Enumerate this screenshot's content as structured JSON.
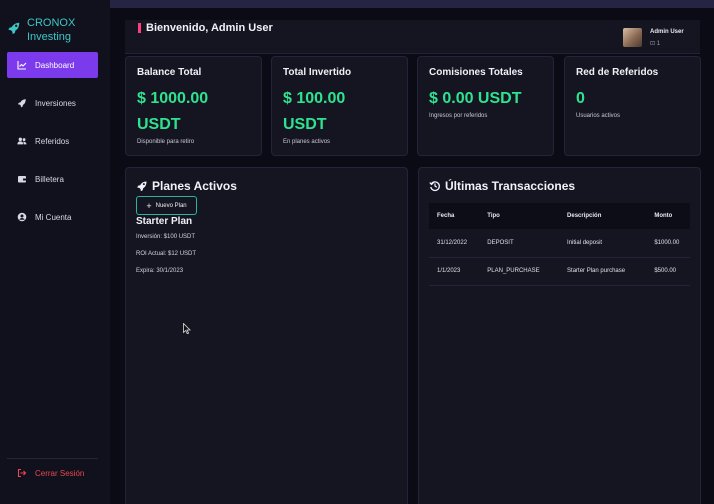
{
  "brand": {
    "line1": "CRONOX",
    "line2": "Investing",
    "icon": "rocket-icon"
  },
  "sidebar": {
    "items": [
      {
        "label": "Dashboard",
        "icon": "chart-line-icon",
        "active": true
      },
      {
        "label": "Inversiones",
        "icon": "rocket-icon",
        "active": false
      },
      {
        "label": "Referidos",
        "icon": "users-icon",
        "active": false
      },
      {
        "label": "Billetera",
        "icon": "wallet-icon",
        "active": false
      },
      {
        "label": "Mi Cuenta",
        "icon": "user-circle-icon",
        "active": false
      }
    ],
    "logout": "Cerrar Sesión"
  },
  "header": {
    "welcome": "Bienvenido, Admin User",
    "user_name": "Admin User",
    "user_role": "⊡ 1"
  },
  "stats": [
    {
      "title": "Balance Total",
      "value_line1": "$ 1000.00",
      "value_line2": "USDT",
      "sub": "Disponible para retiro"
    },
    {
      "title": "Total Invertido",
      "value_line1": "$ 100.00",
      "value_line2": "USDT",
      "sub": "En planes activos"
    },
    {
      "title": "Comisiones Totales",
      "value_line1": "$ 0.00 USDT",
      "value_line2": "",
      "sub": "Ingresos por referidos"
    },
    {
      "title": "Red de Referidos",
      "value_line1": "0",
      "value_line2": "",
      "sub": "Usuarios activos"
    }
  ],
  "plans": {
    "title": "Planes Activos",
    "new_button": "Nuevo Plan",
    "plan_name": "Starter Plan",
    "investment": "Inversión: $100 USDT",
    "roi": "ROI Actual: $12 USDT",
    "expires": "Expira: 30/1/2023"
  },
  "transactions": {
    "title": "Últimas Transacciones",
    "headers": [
      "Fecha",
      "Tipo",
      "Descripción",
      "Monto"
    ],
    "rows": [
      [
        "31/12/2022",
        "DEPOSIT",
        "Initial deposit",
        "$1000.00"
      ],
      [
        "1/1/2023",
        "PLAN_PURCHASE",
        "Starter Plan purchase",
        "$500.00"
      ]
    ]
  },
  "colors": {
    "accent": "#7c3aed",
    "value_green": "#2ee38f",
    "brand_teal": "#3ec6c6",
    "logout_red": "#e8474f",
    "welcome_bar": "#ff3d7f"
  }
}
